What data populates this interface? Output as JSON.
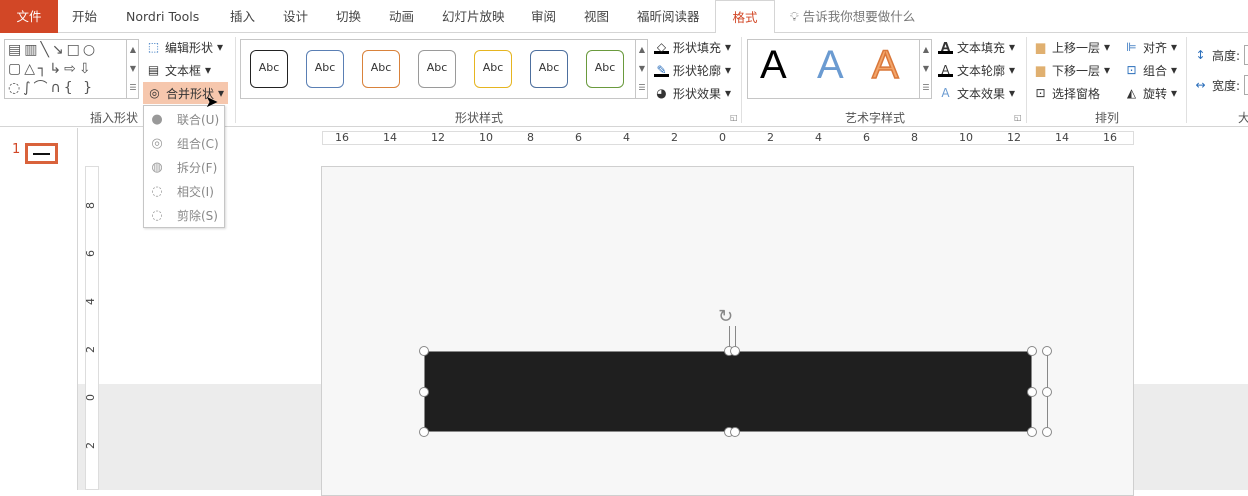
{
  "tabs": {
    "file": "文件",
    "home": "开始",
    "nordri": "Nordri Tools",
    "insert": "插入",
    "design": "设计",
    "transitions": "切换",
    "animations": "动画",
    "slideshow": "幻灯片放映",
    "review": "审阅",
    "view": "视图",
    "foxit": "福昕阅读器",
    "format": "格式",
    "tellme": "告诉我你想要做什么"
  },
  "insert_shapes": {
    "edit_shape": "编辑形状",
    "text_box": "文本框",
    "merge_shapes": "合并形状",
    "group_label": "插入形状"
  },
  "merge_menu": [
    {
      "label": "联合(U)"
    },
    {
      "label": "组合(C)"
    },
    {
      "label": "拆分(F)"
    },
    {
      "label": "相交(I)"
    },
    {
      "label": "剪除(S)"
    }
  ],
  "shape_styles": {
    "preset_text": "Abc",
    "presets": [
      "#222222",
      "#5a7fb4",
      "#d9823b",
      "#9a9a9a",
      "#e6b520",
      "#4d6f9e",
      "#6a9a3d"
    ],
    "fill": "形状填充",
    "outline": "形状轮廓",
    "effects": "形状效果",
    "group_label": "形状样式"
  },
  "wordart": {
    "letter": "A",
    "text_fill": "文本填充",
    "text_outline": "文本轮廓",
    "text_effects": "文本效果",
    "group_label": "艺术字样式"
  },
  "arrange": {
    "bring_forward": "上移一层",
    "send_backward": "下移一层",
    "selection_pane": "选择窗格",
    "align": "对齐",
    "group": "组合",
    "rotate": "旋转",
    "group_label": "排列"
  },
  "size": {
    "height": "高度:",
    "width": "宽度:",
    "group_label": "大"
  },
  "slides": {
    "number": "1"
  },
  "hruler": [
    "16",
    "14",
    "12",
    "10",
    "8",
    "6",
    "4",
    "2",
    "0",
    "2",
    "4",
    "6",
    "8",
    "10",
    "12",
    "14",
    "16"
  ],
  "vruler": [
    "8",
    "6",
    "4",
    "2",
    "0",
    "2"
  ]
}
